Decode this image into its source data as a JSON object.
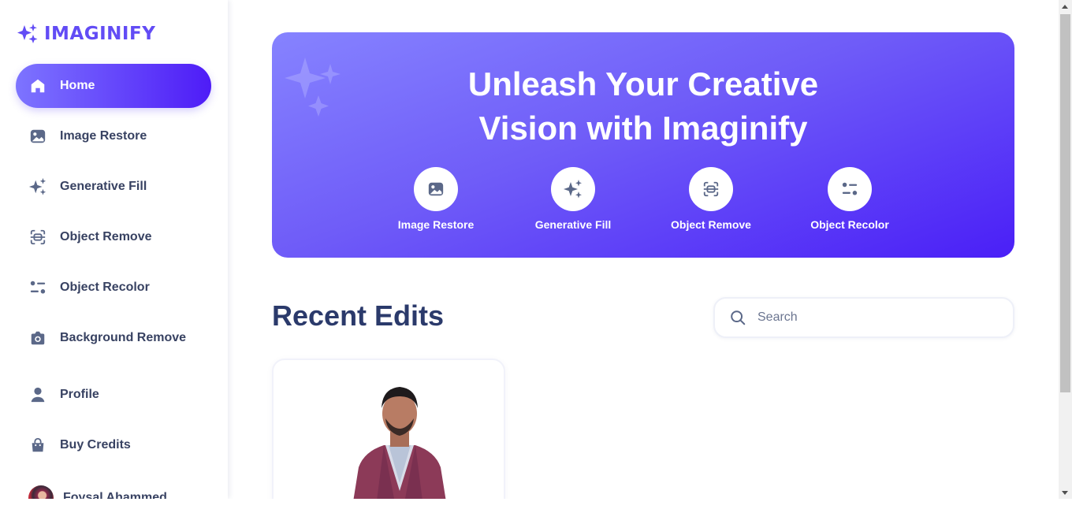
{
  "logo": {
    "text": "IMAGINIFY"
  },
  "sidebar": {
    "items": [
      {
        "label": "Home",
        "icon": "home-icon",
        "active": true
      },
      {
        "label": "Image Restore",
        "icon": "image-icon",
        "active": false
      },
      {
        "label": "Generative Fill",
        "icon": "stars-icon",
        "active": false
      },
      {
        "label": "Object Remove",
        "icon": "scan-icon",
        "active": false
      },
      {
        "label": "Object Recolor",
        "icon": "filter-icon",
        "active": false
      },
      {
        "label": "Background Remove",
        "icon": "camera-icon",
        "active": false
      },
      {
        "label": "Profile",
        "icon": "user-icon",
        "active": false
      },
      {
        "label": "Buy Credits",
        "icon": "bag-icon",
        "active": false
      }
    ],
    "user": {
      "name": "Foysal Ahammed"
    }
  },
  "banner": {
    "title_line1": "Unleash Your Creative",
    "title_line2": "Vision with Imaginify",
    "tools": [
      {
        "label": "Image Restore",
        "icon": "image-icon"
      },
      {
        "label": "Generative Fill",
        "icon": "stars-icon"
      },
      {
        "label": "Object Remove",
        "icon": "scan-icon"
      },
      {
        "label": "Object Recolor",
        "icon": "filter-icon"
      }
    ]
  },
  "recent": {
    "title": "Recent Edits"
  },
  "search": {
    "placeholder": "Search",
    "value": ""
  },
  "colors": {
    "accent": "#624cf5",
    "text": "#384262",
    "heading": "#2b3a6b"
  }
}
